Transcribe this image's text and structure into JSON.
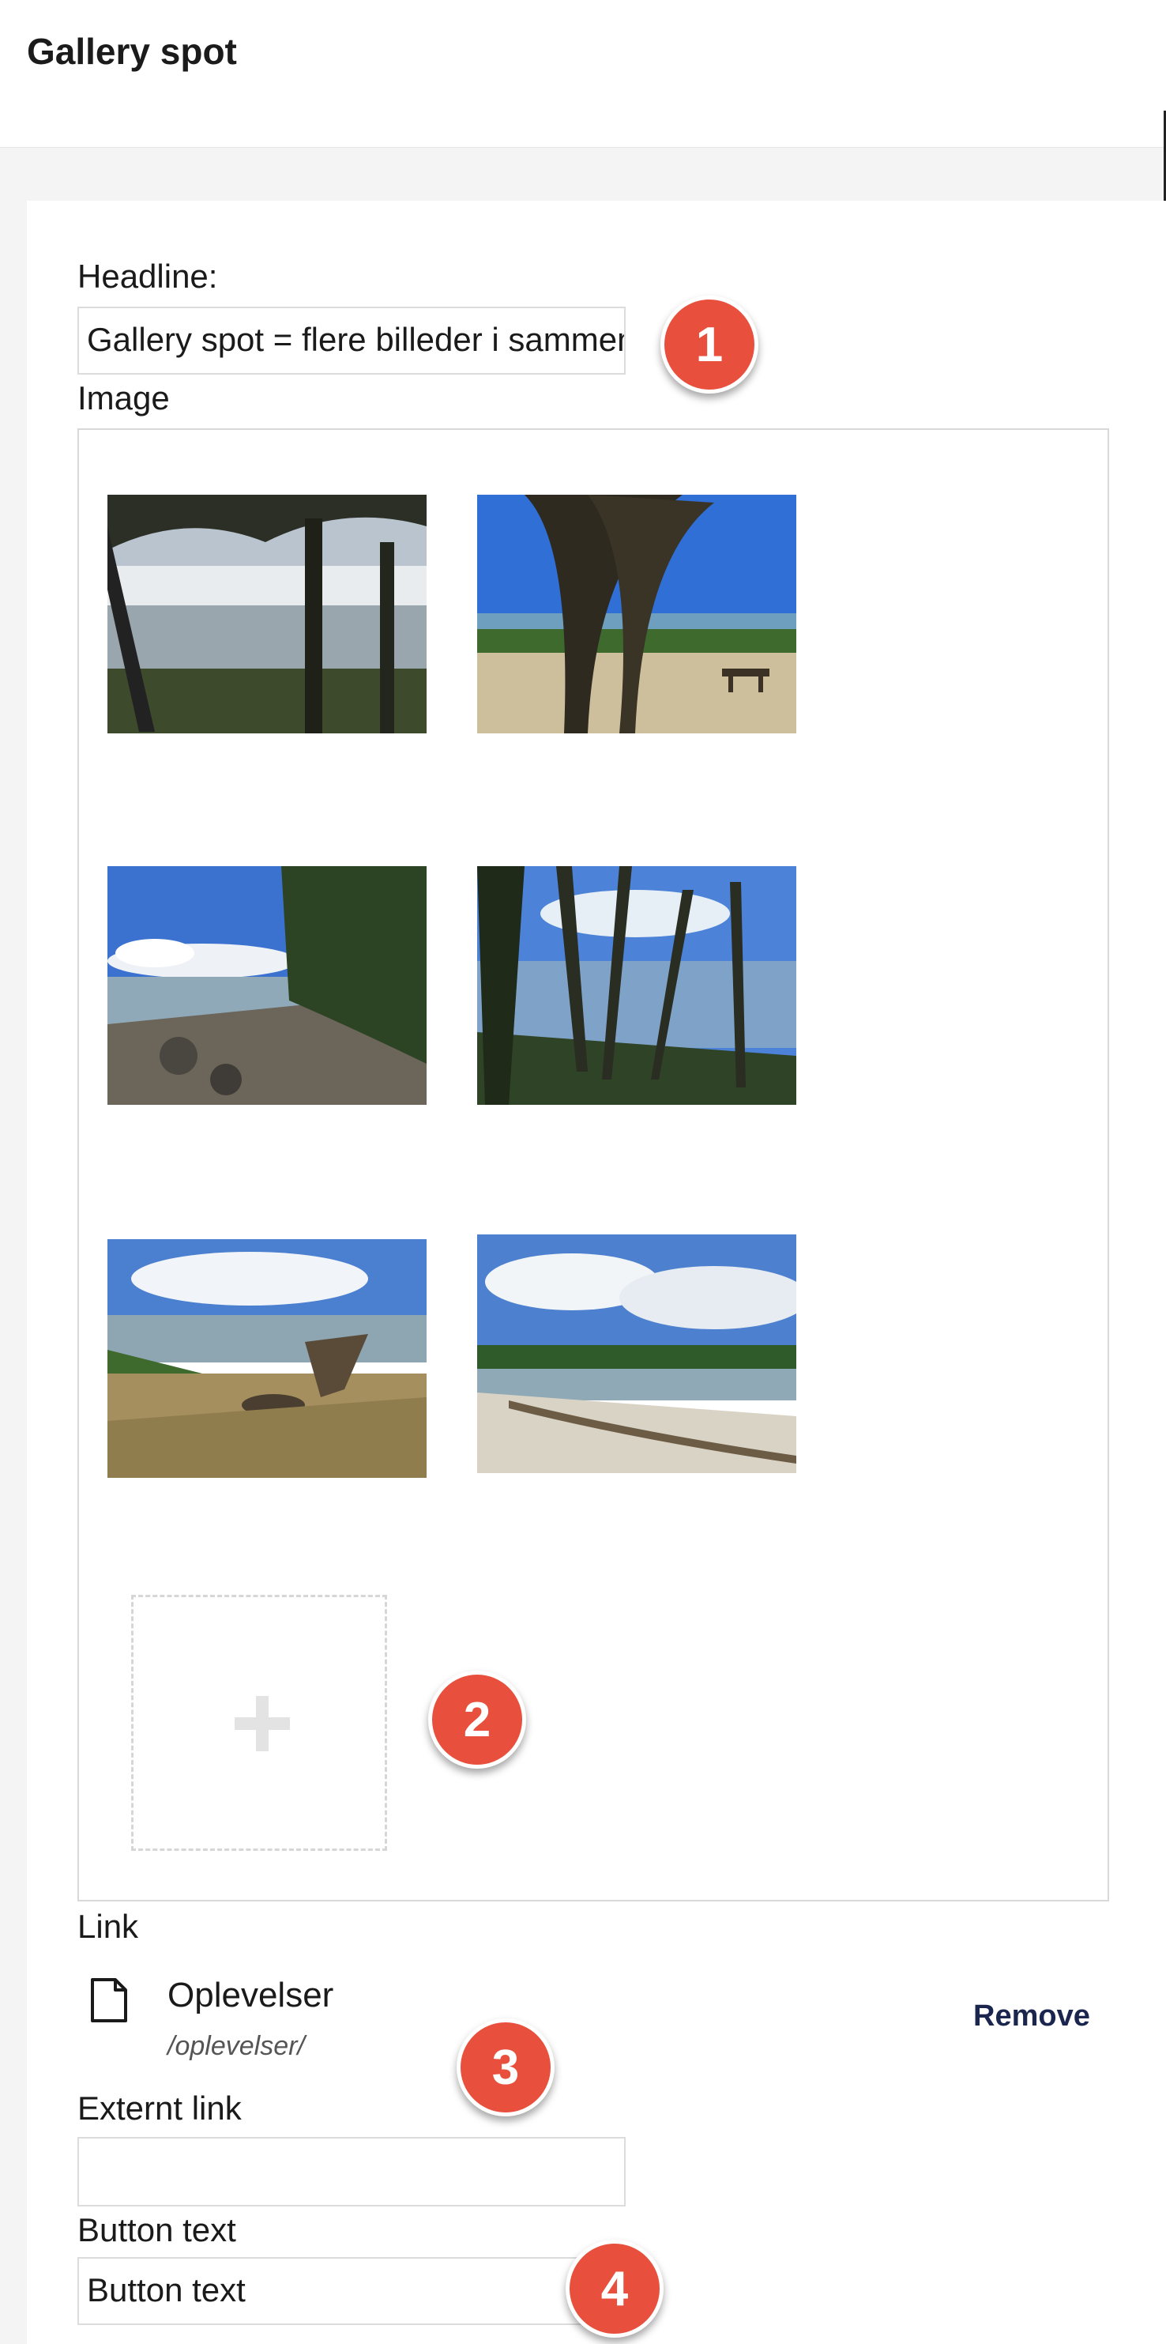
{
  "header": {
    "title": "Gallery spot"
  },
  "form": {
    "headline_label": "Headline:",
    "headline_value": "Gallery spot = flere billeder i sammen",
    "image_label": "Image",
    "link_label": "Link",
    "link": {
      "name": "Oplevelser",
      "url": "/oplevelser/",
      "remove_label": "Remove"
    },
    "external_link_label": "Externt link",
    "external_link_value": "",
    "button_text_label": "Button text",
    "button_text_value": "Button text"
  },
  "gallery": {
    "images": [
      {
        "scene": "coast-trees-sunlight"
      },
      {
        "scene": "tree-picnic-shore"
      },
      {
        "scene": "rocky-beach-clouds"
      },
      {
        "scene": "slanted-trees-water"
      },
      {
        "scene": "driftwood-beach"
      },
      {
        "scene": "sandy-shore-clouds"
      }
    ],
    "add_icon": "plus-icon"
  },
  "badges": [
    "1",
    "2",
    "3",
    "4"
  ],
  "colors": {
    "accent": "#1b264f",
    "badge": "#e8503d"
  }
}
